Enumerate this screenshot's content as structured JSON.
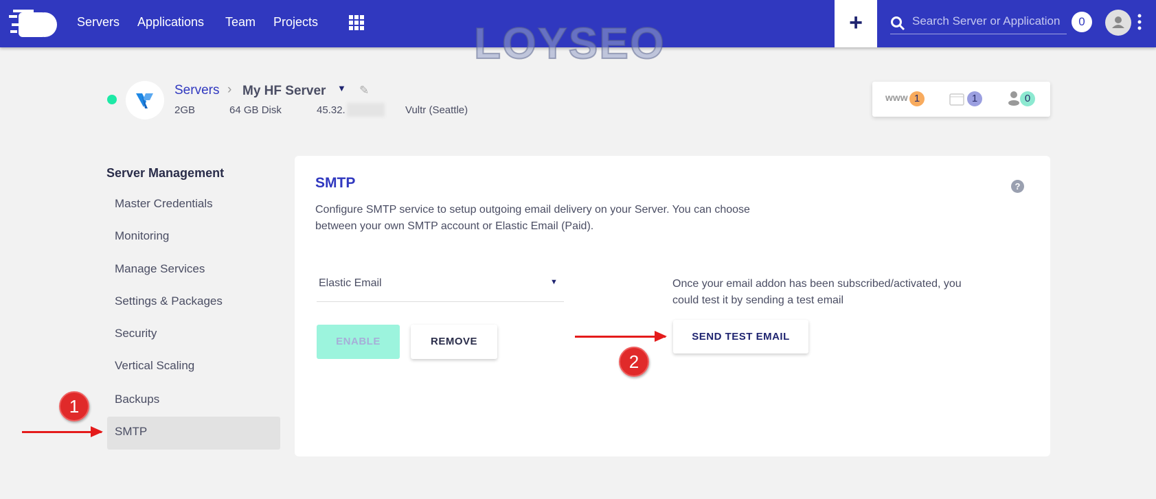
{
  "header": {
    "nav": [
      "Servers",
      "Applications",
      "Team",
      "Projects"
    ],
    "search_placeholder": "Search Server or Application",
    "notifications": "0",
    "brand_color": "#3038bf"
  },
  "watermark": "LOYSEO",
  "server": {
    "breadcrumb_root": "Servers",
    "name": "My HF Server",
    "ram": "2GB",
    "disk": "64 GB Disk",
    "ip": "45.32.",
    "provider": "Vultr (Seattle)",
    "status": "online"
  },
  "stats": {
    "www": "www",
    "apps": "1",
    "folders": "1",
    "users": "0"
  },
  "sidebar": {
    "title": "Server Management",
    "items": [
      "Master Credentials",
      "Monitoring",
      "Manage Services",
      "Settings & Packages",
      "Security",
      "Vertical Scaling",
      "Backups",
      "SMTP"
    ],
    "active": "SMTP"
  },
  "smtp": {
    "title": "SMTP",
    "desc_line1": "Configure SMTP service to setup outgoing email delivery on your Server. You can choose",
    "desc_line2": "between your own SMTP account or Elastic Email (Paid).",
    "provider_selected": "Elastic Email",
    "enable_label": "ENABLE",
    "remove_label": "REMOVE",
    "test_line1": "Once your email addon has been subscribed/activated, you",
    "test_line2": "could test it by sending a test email",
    "send_test_label": "SEND TEST EMAIL"
  },
  "annotations": {
    "step1": "1",
    "step2": "2"
  }
}
